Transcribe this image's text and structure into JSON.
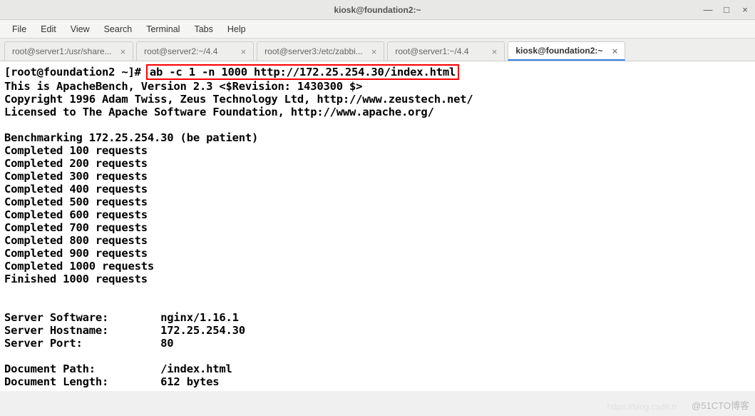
{
  "window": {
    "title": "kiosk@foundation2:~",
    "btn_min": "—",
    "btn_max": "□",
    "btn_close": "×"
  },
  "menubar": {
    "file": "File",
    "edit": "Edit",
    "view": "View",
    "search": "Search",
    "terminal": "Terminal",
    "tabs": "Tabs",
    "help": "Help"
  },
  "tabs": [
    {
      "label": "root@server1:/usr/share...",
      "active": false
    },
    {
      "label": "root@server2:~/4.4",
      "active": false
    },
    {
      "label": "root@server3:/etc/zabbi...",
      "active": false
    },
    {
      "label": "root@server1:~/4.4",
      "active": false
    },
    {
      "label": "kiosk@foundation2:~",
      "active": true
    }
  ],
  "terminal": {
    "prompt": "[root@foundation2 ~]# ",
    "command": "ab -c 1 -n 1000 http://172.25.254.30/index.html",
    "lines": [
      "This is ApacheBench, Version 2.3 <$Revision: 1430300 $>",
      "Copyright 1996 Adam Twiss, Zeus Technology Ltd, http://www.zeustech.net/",
      "Licensed to The Apache Software Foundation, http://www.apache.org/",
      "",
      "Benchmarking 172.25.254.30 (be patient)",
      "Completed 100 requests",
      "Completed 200 requests",
      "Completed 300 requests",
      "Completed 400 requests",
      "Completed 500 requests",
      "Completed 600 requests",
      "Completed 700 requests",
      "Completed 800 requests",
      "Completed 900 requests",
      "Completed 1000 requests",
      "Finished 1000 requests",
      "",
      "",
      "Server Software:        nginx/1.16.1",
      "Server Hostname:        172.25.254.30",
      "Server Port:            80",
      "",
      "Document Path:          /index.html",
      "Document Length:        612 bytes"
    ]
  },
  "watermark": {
    "text1": "https://blog.csdn.n",
    "text2": "@51CTO博客"
  }
}
